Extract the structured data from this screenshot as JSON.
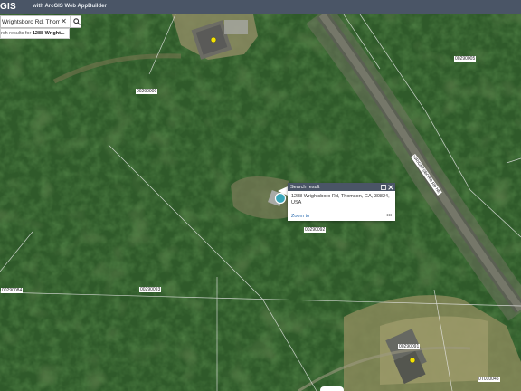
{
  "header": {
    "app_title": "GIS",
    "builder_label": "with ArcGIS Web AppBuilder"
  },
  "search": {
    "value": "Wrightsboro Rd, Thomson",
    "clear_icon": "close-icon",
    "search_icon": "search-icon",
    "suggestion_prefix": "rch results for",
    "suggestion_match": "1288 Wright..."
  },
  "parcels": {
    "p1": "00290000",
    "p2": "00290005",
    "p3": "00290092",
    "p4": "00290084",
    "p5": "00290093",
    "p6": "00290091",
    "p7": "0T010045"
  },
  "road_label": "WRIGHTSBORO RD NE",
  "popup": {
    "title": "Search result",
    "address": "1288 Wrightsboro Rd, Thomson, GA, 30824, USA",
    "zoom_label": "Zoom to",
    "more_label": "•••",
    "maximize_icon": "maximize-icon",
    "close_icon": "close-icon"
  },
  "colors": {
    "header_bg": "#4a5566",
    "link": "#2b6cb0",
    "marker": "#3aa6b9"
  }
}
